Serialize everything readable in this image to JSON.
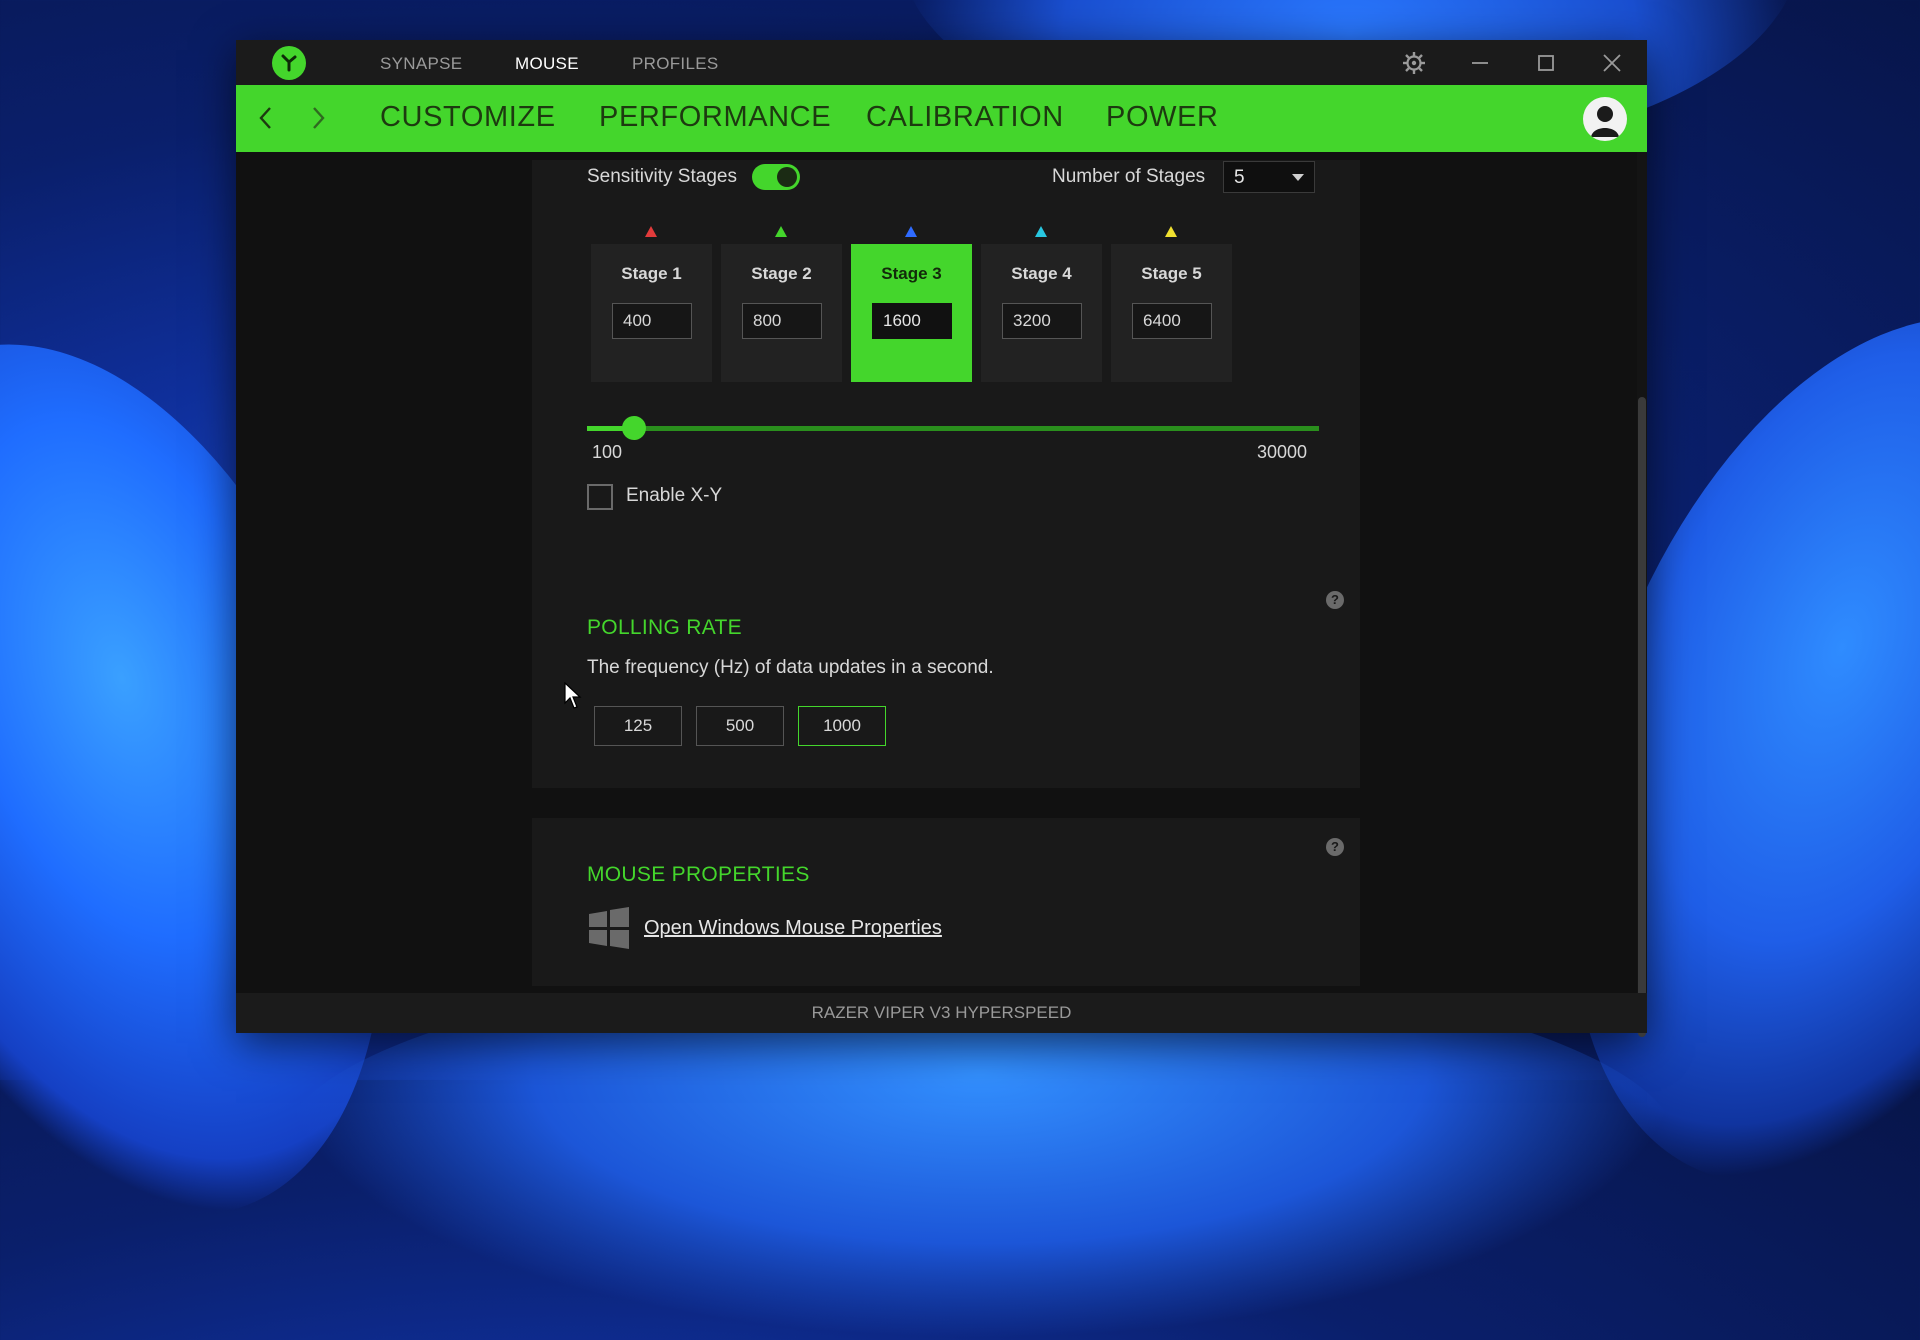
{
  "window": {
    "top_tabs": [
      "SYNAPSE",
      "MOUSE",
      "PROFILES"
    ],
    "active_top_tab": "MOUSE",
    "sub_tabs": [
      "CUSTOMIZE",
      "PERFORMANCE",
      "CALIBRATION",
      "POWER"
    ],
    "active_sub_tab": "PERFORMANCE",
    "device_name": "RAZER VIPER V3 HYPERSPEED"
  },
  "sensitivity": {
    "label": "Sensitivity Stages",
    "enabled": true,
    "stages_label": "Number of Stages",
    "stages_count": "5",
    "stages": [
      {
        "title": "Stage 1",
        "value": "400",
        "color": "#e23b3b"
      },
      {
        "title": "Stage 2",
        "value": "800",
        "color": "#44d62c"
      },
      {
        "title": "Stage 3",
        "value": "1600",
        "color": "#2f6bff"
      },
      {
        "title": "Stage 4",
        "value": "3200",
        "color": "#28c7e0"
      },
      {
        "title": "Stage 5",
        "value": "6400",
        "color": "#f0e030"
      }
    ],
    "active_stage": 3,
    "slider_min": "100",
    "slider_max": "30000",
    "enable_xy_label": "Enable X-Y",
    "enable_xy_checked": false
  },
  "polling": {
    "title": "POLLING RATE",
    "description": "The frequency (Hz) of data updates in a second.",
    "options": [
      "125",
      "500",
      "1000"
    ],
    "selected": "1000"
  },
  "mouse_properties": {
    "title": "MOUSE PROPERTIES",
    "link": "Open Windows Mouse Properties"
  },
  "icons": {
    "help": "?"
  },
  "colors": {
    "accent": "#44d62c",
    "panel": "#191919",
    "background": "#111111"
  }
}
